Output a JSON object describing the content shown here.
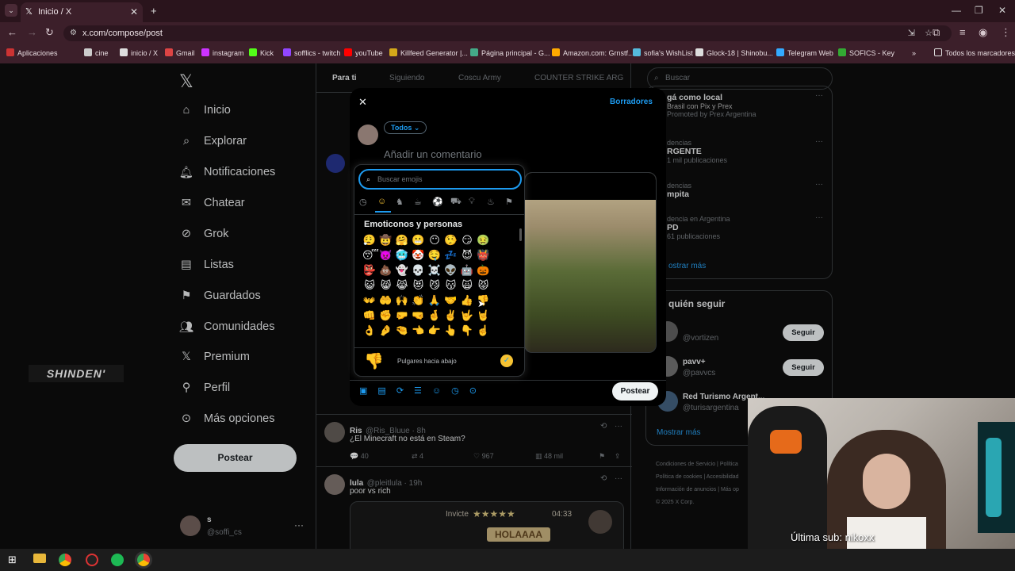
{
  "browser": {
    "tab_title": "Inicio / X",
    "url": "x.com/compose/post",
    "bookmarks": [
      "Aplicaciones",
      "cine",
      "inicio / X",
      "Gmail",
      "instagram",
      "Kick",
      "sofflics - twitch",
      "youTube",
      "Killfeed Generator |...",
      "Página principal - G...",
      "Amazon.com: Grnstf...",
      "sofia's WishList",
      "Glock-18 | Shinobu...",
      "Telegram Web",
      "SOFICS - Key"
    ],
    "all_bookmarks": "Todos los marcadores"
  },
  "sidebar": {
    "logo": "x-logo-icon",
    "items": [
      {
        "label": "Inicio",
        "icon": "home-icon"
      },
      {
        "label": "Explorar",
        "icon": "search-icon"
      },
      {
        "label": "Notificaciones",
        "icon": "bell-icon"
      },
      {
        "label": "Chatear",
        "icon": "mail-icon"
      },
      {
        "label": "Grok",
        "icon": "grok-icon"
      },
      {
        "label": "Listas",
        "icon": "list-icon"
      },
      {
        "label": "Guardados",
        "icon": "bookmark-icon"
      },
      {
        "label": "Comunidades",
        "icon": "people-icon"
      },
      {
        "label": "Premium",
        "icon": "x-icon"
      },
      {
        "label": "Perfil",
        "icon": "person-icon"
      },
      {
        "label": "Más opciones",
        "icon": "more-circle-icon"
      }
    ],
    "post_button": "Postear",
    "account": {
      "name": "s",
      "handle": "@soffi_cs"
    }
  },
  "overlay": {
    "shinden": "SHINDEN'"
  },
  "feed": {
    "tabs": [
      "Para ti",
      "Siguiendo",
      "Coscu Army",
      "COUNTER STRIKE ARG"
    ],
    "tweets": [
      {
        "name": "Ris",
        "handle": "@Ris_Bluue · 8h",
        "text": "¿El Minecraft no está en Steam?",
        "replies": "40",
        "retweets": "4",
        "likes": "967",
        "views": "48 mil"
      },
      {
        "name": "lula",
        "handle": "@pleitlula · 19h",
        "text": "poor vs rich"
      }
    ],
    "stream_overlay": {
      "invite": "Invicte",
      "time": "04:33",
      "hola": "HOLAAAA"
    }
  },
  "right": {
    "search_placeholder": "Buscar",
    "trends": [
      {
        "l1": "gá como local",
        "l2": "Brasil con Pix y Prex",
        "l3": "Promoted by Prex Argentina"
      },
      {
        "l1": "dencias",
        "l2": "RGENTE",
        "l3": "1 mil publicaciones"
      },
      {
        "l1": "dencias",
        "l2": "mpita",
        "l3": ""
      },
      {
        "l1": "dencia en Argentina",
        "l2": "PD",
        "l3": "61 publicaciones"
      }
    ],
    "show_more": "ostrar más",
    "who_title": "quién seguir",
    "follow": [
      {
        "name": "",
        "handle": "@vortizen",
        "btn": "Seguir"
      },
      {
        "name": "pavv+",
        "handle": "@pavvcs",
        "btn": "Seguir"
      },
      {
        "name": "Red Turismo Argent...",
        "handle": "@turisargentina",
        "btn": ""
      }
    ],
    "show_more2": "Mostrar más",
    "footer": [
      "Condiciones de Servicio",
      "Política",
      "Política de cookies",
      "Accesibilidad",
      "Información de anuncios",
      "Más op",
      "© 2025 X Corp."
    ]
  },
  "modal": {
    "drafts": "Borradores",
    "audience": "Todos",
    "comment_placeholder": "Añadir un comentario",
    "post_button": "Postear"
  },
  "emoji": {
    "search_placeholder": "Buscar emojis",
    "section": "Emoticonos y personas",
    "hover_name": "Pulgares hacia abajo",
    "hover_glyph": "👎",
    "grid": [
      "😮‍💨",
      "🤠",
      "🤗",
      "😬",
      "😶",
      "🤥",
      "😏",
      "🤢",
      "😴",
      "👿",
      "🥶",
      "🤡",
      "🤤",
      "💤",
      "😈",
      "👹",
      "👺",
      "💩",
      "👻",
      "💀",
      "☠️",
      "👽",
      "🤖",
      "🎃",
      "😺",
      "😸",
      "😹",
      "😻",
      "😼",
      "😽",
      "🙀",
      "😾",
      "👐",
      "🤲",
      "🙌",
      "👏",
      "🙏",
      "🤝",
      "👍",
      "👎",
      "👊",
      "✊",
      "🤛",
      "🤜",
      "🤞",
      "✌️",
      "🤟",
      "🤘",
      "👌",
      "🤌",
      "🤏",
      "👈",
      "👉",
      "👆",
      "👇",
      "☝️"
    ]
  },
  "webcam": {
    "caption": "Última sub: nikoxx"
  },
  "colors": {
    "accent": "#1d9bf0",
    "bg": "#000000",
    "chrome": "#3c1f2a"
  }
}
